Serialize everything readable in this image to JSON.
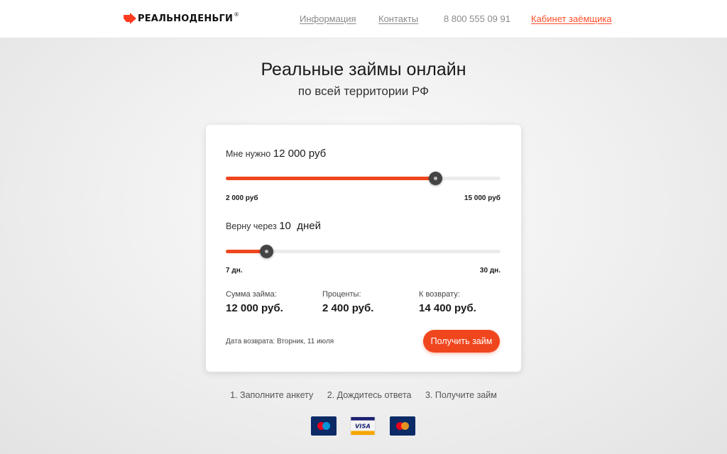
{
  "header": {
    "logo_text": "РЕАЛЬНОДЕНЬГИ",
    "logo_reg": "®",
    "nav": {
      "info": "Информация",
      "contacts": "Контакты",
      "phone": "8 800 555 09 91",
      "cabinet": "Кабинет заёмщика"
    }
  },
  "hero": {
    "title": "Реальные займы онлайн",
    "subtitle": "по всей территории РФ"
  },
  "calculator": {
    "amount": {
      "prefix": "Мне нужно",
      "value": "12 000 руб",
      "min_label": "2 000 руб",
      "max_label": "15 000 руб",
      "fraction": 0.7615
    },
    "term": {
      "prefix": "Верну через",
      "value": "10  дней",
      "min_label": "7 дн.",
      "max_label": "30 дн.",
      "fraction": 0.1478
    },
    "summary": {
      "loan_label": "Сумма займа:",
      "loan_value": "12 000 руб.",
      "interest_label": "Проценты:",
      "interest_value": "2 400 руб.",
      "return_label": "К возврату:",
      "return_value": "14 400 руб."
    },
    "return_date": "Дата возврата: Вторник, 11 июля",
    "cta_label": "Получить займ"
  },
  "steps": [
    "1. Заполните анкету",
    "2. Дождитесь ответа",
    "3. Получите займ"
  ],
  "payments": {
    "visa_label": "VISA"
  },
  "colors": {
    "accent": "#f0461e",
    "link": "#8a8a8a",
    "cabinet": "#ff4e2a",
    "knob": "#444444"
  }
}
